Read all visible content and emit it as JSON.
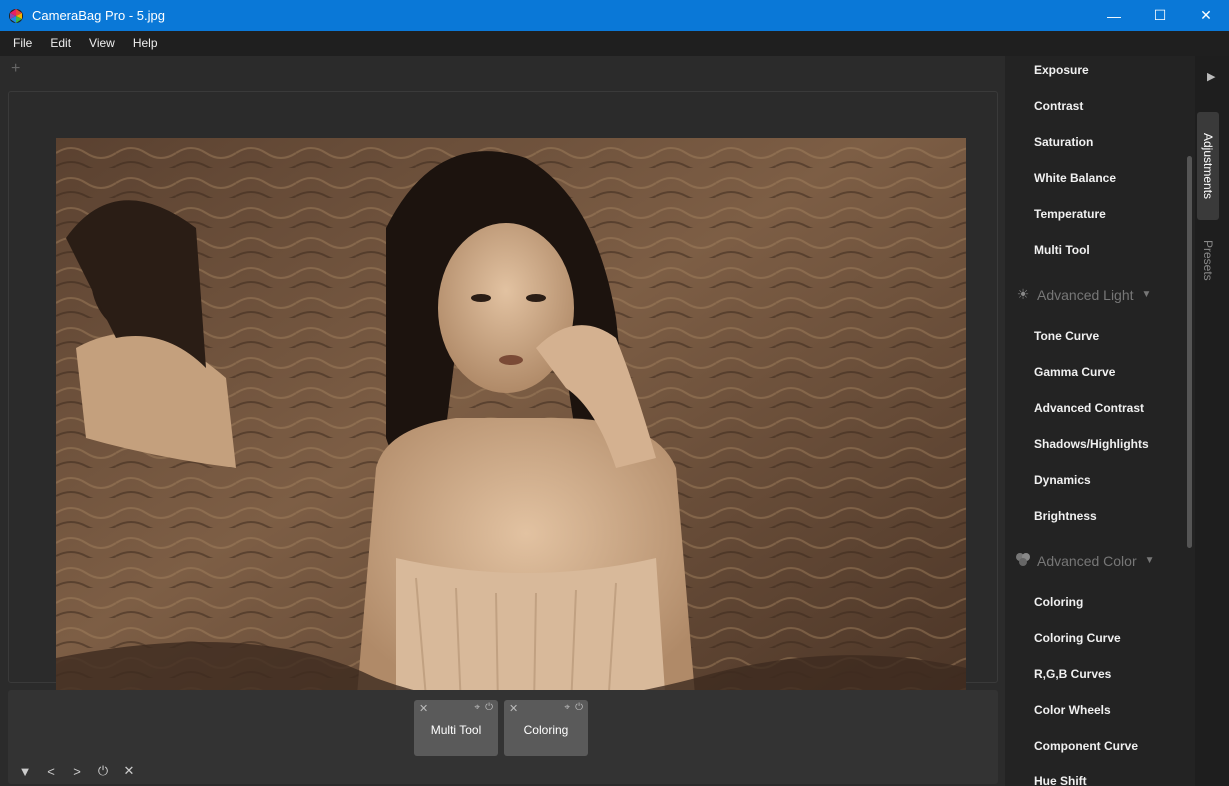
{
  "window": {
    "title": "CameraBag Pro - 5.jpg",
    "minimize": "—",
    "maximize": "☐",
    "close": "✕",
    "titlebar_color": "#0a78d7"
  },
  "menu": {
    "items": [
      "File",
      "Edit",
      "View",
      "Help"
    ]
  },
  "canvas": {
    "add_tab": "+",
    "image_alt": "sepia photo"
  },
  "tool_tray": {
    "cards": [
      {
        "label": "Multi Tool",
        "close": "✕",
        "pin": "📌",
        "power": "⏻"
      },
      {
        "label": "Coloring",
        "close": "✕",
        "pin": "📌",
        "power": "⏻"
      }
    ],
    "controls": {
      "menu": "▼",
      "prev": "<",
      "next": ">",
      "power": "⏻",
      "clear": "✕"
    }
  },
  "adjustments": {
    "basic": [
      "Exposure",
      "Contrast",
      "Saturation",
      "White Balance",
      "Temperature",
      "Multi Tool"
    ],
    "advanced_light": {
      "title": "Advanced Light",
      "icon": "sun-icon",
      "items": [
        "Tone Curve",
        "Gamma Curve",
        "Advanced Contrast",
        "Shadows/Highlights",
        "Dynamics",
        "Brightness"
      ]
    },
    "advanced_color": {
      "title": "Advanced Color",
      "icon": "color-circles-icon",
      "items": [
        "Coloring",
        "Coloring Curve",
        "R,G,B Curves",
        "Color Wheels",
        "Component Curve",
        "Hue Shift"
      ]
    }
  },
  "side_tabs": {
    "arrow": "▶",
    "adjustments": "Adjustments",
    "presets": "Presets"
  }
}
